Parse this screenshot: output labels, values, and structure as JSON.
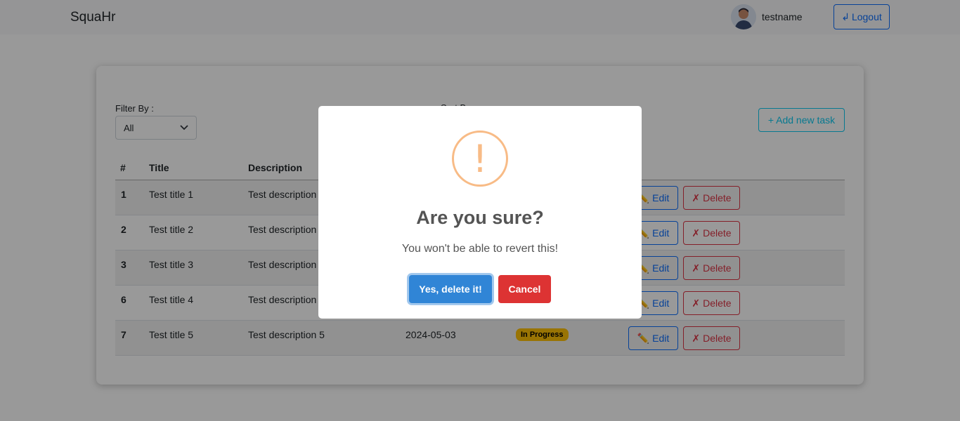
{
  "navbar": {
    "brand": "SquaHr",
    "username": "testname",
    "logout_label": "Logout",
    "logout_icon": "↲"
  },
  "filters": {
    "filter_label": "Filter By :",
    "filter_value": "All",
    "sort_label": "Sort By :",
    "add_label": "+ Add new task"
  },
  "table": {
    "headers": [
      "#",
      "Title",
      "Description"
    ],
    "rows": [
      {
        "num": "1",
        "title": "Test title 1",
        "description": "Test description",
        "date": "",
        "status": ""
      },
      {
        "num": "2",
        "title": "Test title 2",
        "description": "Test description",
        "date": "",
        "status": ""
      },
      {
        "num": "3",
        "title": "Test title 3",
        "description": "Test description",
        "date": "",
        "status": ""
      },
      {
        "num": "6",
        "title": "Test title 4",
        "description": "Test description",
        "date": "",
        "status": ""
      },
      {
        "num": "7",
        "title": "Test title 5",
        "description": "Test description 5",
        "date": "2024-05-03",
        "status": "In Progress"
      }
    ],
    "edit_label": "Edit",
    "edit_icon": "✏️",
    "delete_label": "Delete",
    "delete_icon": "✗"
  },
  "modal": {
    "icon": "!",
    "title": "Are you sure?",
    "text": "You won't be able to revert this!",
    "confirm_label": "Yes, delete it!",
    "cancel_label": "Cancel"
  },
  "colors": {
    "primary": "#0d6efd",
    "danger": "#dc3545",
    "info": "#0dcaf0",
    "warning": "#ffc107",
    "swal_confirm": "#3085d6",
    "swal_cancel": "#dd3333",
    "swal_warning": "#f8bb86"
  }
}
